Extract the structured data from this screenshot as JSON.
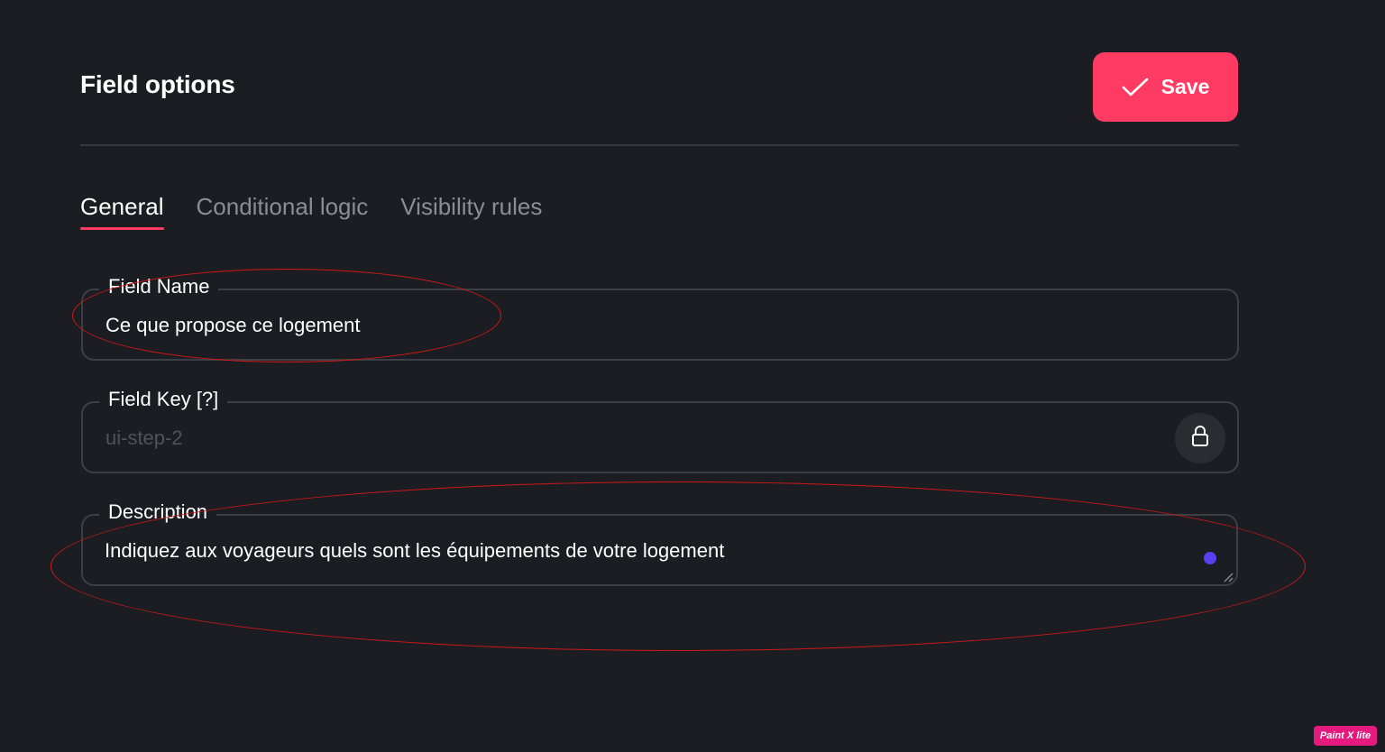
{
  "header": {
    "title": "Field options",
    "save_label": "Save"
  },
  "tabs": [
    {
      "label": "General",
      "active": true
    },
    {
      "label": "Conditional logic",
      "active": false
    },
    {
      "label": "Visibility rules",
      "active": false
    }
  ],
  "fields": {
    "field_name": {
      "label": "Field Name",
      "value": "Ce que propose ce logement"
    },
    "field_key": {
      "label": "Field Key [?]",
      "value": "ui-step-2",
      "locked": true,
      "icon": "lock-icon"
    },
    "description": {
      "label": "Description",
      "value": "Indiquez aux voyageurs quels sont les équipements de votre logement"
    }
  },
  "watermark": "Paint X lite",
  "colors": {
    "background": "#1b1d22",
    "accent": "#ff3b63",
    "annotation": "#d01818",
    "indicator": "#5a3ff0"
  }
}
